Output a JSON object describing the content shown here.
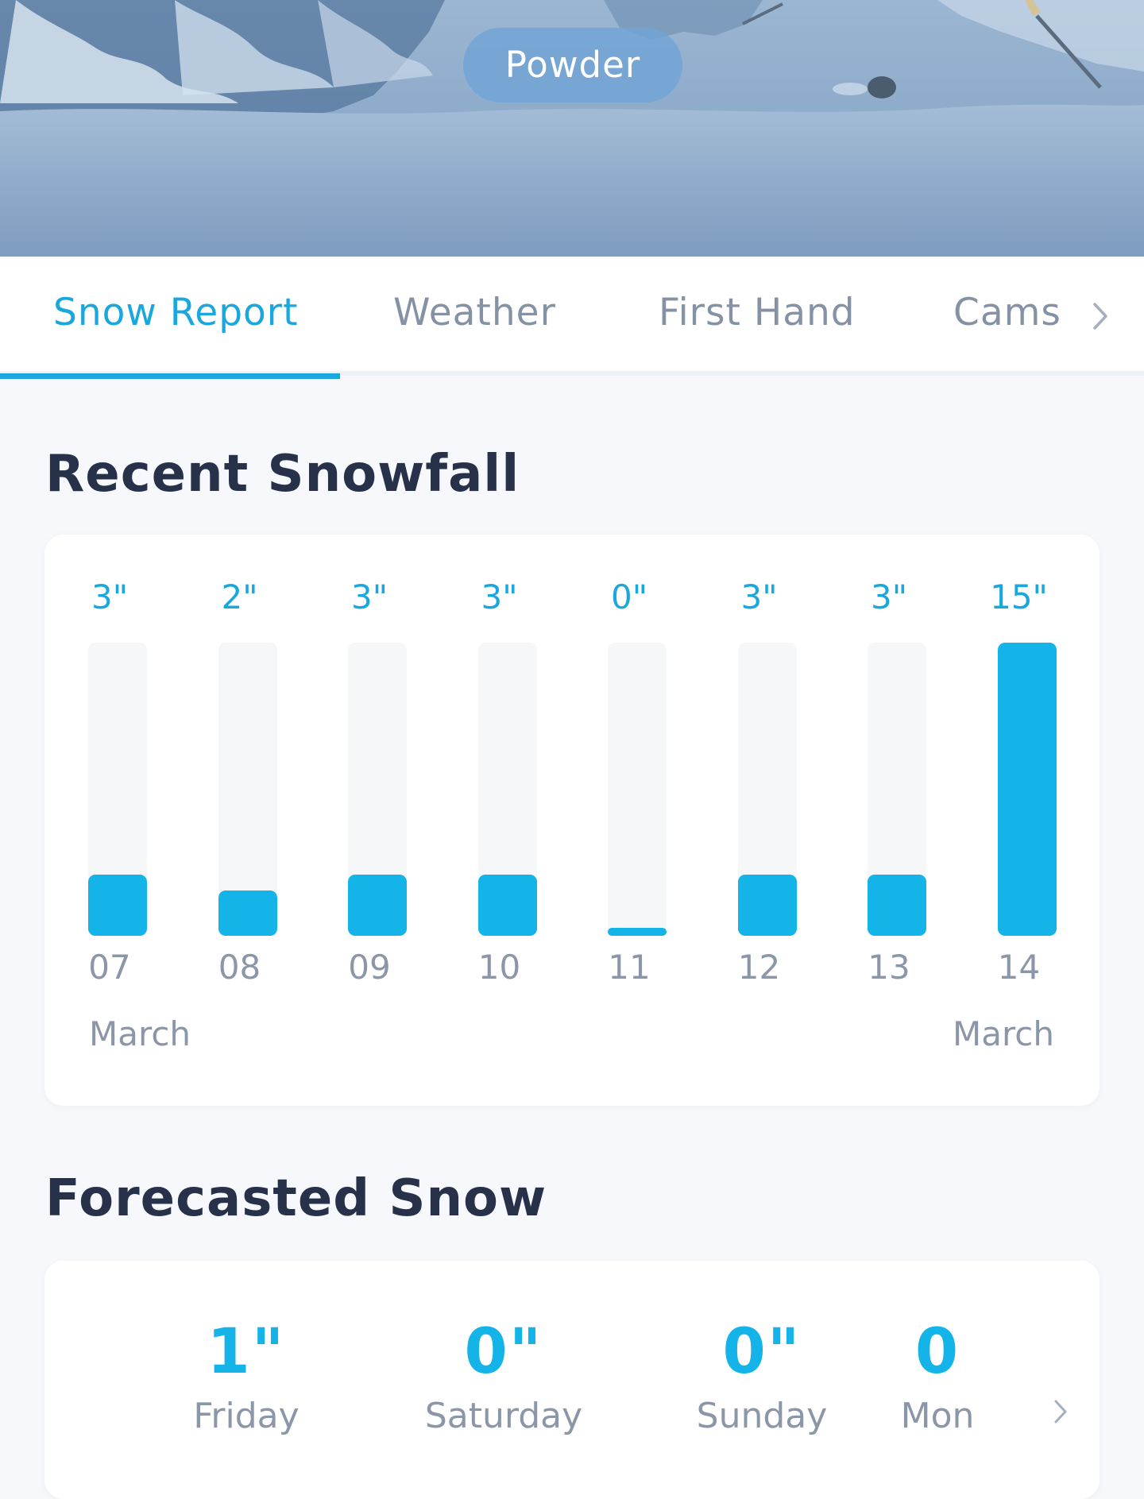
{
  "hero": {
    "badge": "Powder"
  },
  "tabs": [
    {
      "label": "Snow Report",
      "active": true
    },
    {
      "label": "Weather",
      "active": false
    },
    {
      "label": "First Hand",
      "active": false
    },
    {
      "label": "Cams",
      "active": false
    }
  ],
  "recent_snowfall": {
    "title": "Recent Snowfall",
    "start_month": "March",
    "end_month": "March"
  },
  "chart_data": {
    "type": "bar",
    "title": "Recent Snowfall",
    "categories": [
      "07",
      "08",
      "09",
      "10",
      "11",
      "12",
      "13",
      "14"
    ],
    "values": [
      3,
      2,
      3,
      3,
      0,
      3,
      3,
      15
    ],
    "value_labels": [
      "3\"",
      "2\"",
      "3\"",
      "3\"",
      "0\"",
      "3\"",
      "3\"",
      "15\""
    ],
    "unit": "inches",
    "ylim": [
      0,
      15
    ],
    "xlabel": "",
    "ylabel": "",
    "grid": false,
    "colors": {
      "bar": "#14b3e8",
      "track": "#f6f7f9",
      "label": "#1aa7de"
    }
  },
  "forecast": {
    "title": "Forecasted Snow",
    "days": [
      {
        "value": "1\"",
        "day": "Friday"
      },
      {
        "value": "0\"",
        "day": "Saturday"
      },
      {
        "value": "0\"",
        "day": "Sunday"
      },
      {
        "value": "0",
        "day": "Mon"
      }
    ]
  },
  "colors": {
    "accent": "#1aa7de",
    "heading": "#27324a",
    "muted": "#8b96a8",
    "background": "#f6f8fb"
  },
  "icons": {
    "tabs_more": "chevron-right-icon",
    "forecast_more": "chevron-right-icon"
  }
}
